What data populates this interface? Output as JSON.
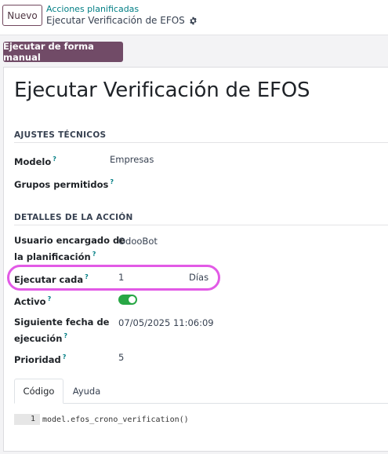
{
  "header": {
    "new_button": "Nuevo",
    "breadcrumb_parent": "Acciones planificadas",
    "breadcrumb_current": "Ejecutar Verificación de EFOS"
  },
  "toolbar": {
    "run_button": "Ejecutar de forma manual"
  },
  "form": {
    "title": "Ejecutar Verificación de EFOS",
    "technical": {
      "section_title": "AJUSTES TÉCNICOS",
      "model_label": "Modelo",
      "model_value": "Empresas",
      "groups_label": "Grupos permitidos"
    },
    "action": {
      "section_title": "DETALLES DE LA ACCIÓN",
      "user_label_1": "Usuario encargado de",
      "user_label_2": "la planificación",
      "user_value": "OdooBot",
      "interval_label": "Ejecutar cada",
      "interval_number": "1",
      "interval_unit": "Días",
      "active_label": "Activo",
      "active_value": true,
      "nextcall_label_1": "Siguiente fecha de",
      "nextcall_label_2": "ejecución",
      "nextcall_value": "07/05/2025 11:06:09",
      "priority_label": "Prioridad",
      "priority_value": "5"
    },
    "help_mark": "?",
    "tabs": [
      {
        "label": "Código",
        "active": true
      },
      {
        "label": "Ayuda",
        "active": false
      }
    ],
    "code": {
      "line_number": "1",
      "object": "model",
      "method": "efos_crono_verification",
      "suffix": "()"
    }
  },
  "colors": {
    "primary": "#714b67",
    "link": "#017e84",
    "toggle_on": "#28a745",
    "highlight": "#e25ae6"
  }
}
